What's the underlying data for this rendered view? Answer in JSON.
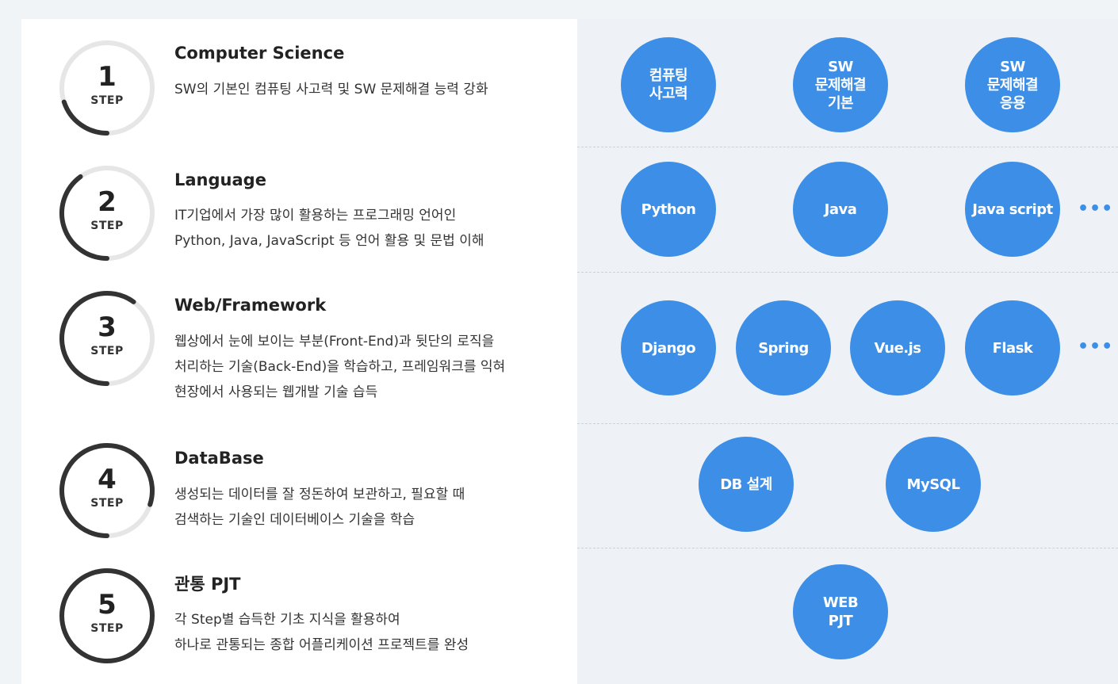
{
  "steps": [
    {
      "number": "1",
      "step_label": "STEP",
      "title": "Computer Science",
      "desc": [
        "SW의 기본인 컴퓨팅 사고력 및 SW 문제해결 능력 강화"
      ],
      "progress": 0.2
    },
    {
      "number": "2",
      "step_label": "STEP",
      "title": "Language",
      "desc": [
        "IT기업에서 가장 많이 활용하는 프로그래밍 언어인",
        "Python, Java, JavaScript 등 언어 활용 및 문법 이해"
      ],
      "progress": 0.4
    },
    {
      "number": "3",
      "step_label": "STEP",
      "title": "Web/Framework",
      "desc": [
        "웹상에서  눈에 보이는 부분(Front-End)과  뒷단의 로직을",
        "처리하는 기술(Back-End)을 학습하고, 프레임워크를 익혀",
        "현장에서 사용되는  웹개발 기술 습득"
      ],
      "progress": 0.6
    },
    {
      "number": "4",
      "step_label": "STEP",
      "title": "DataBase",
      "desc": [
        "생성되는 데이터를  잘 정돈하여 보관하고, 필요할 때",
        "검색하는 기술인 데이터베이스 기술을  학습"
      ],
      "progress": 0.8
    },
    {
      "number": "5",
      "step_label": "STEP",
      "title": "관통 PJT",
      "desc": [
        "각 Step별 습득한 기초 지식을 활용하여",
        "하나로 관통되는 종합 어플리케이션 프로젝트를 완성"
      ],
      "progress": 1.0
    }
  ],
  "topics": {
    "row1": [
      "컴퓨팅\n사고력",
      "SW\n문제해결\n기본",
      "SW\n문제해결\n응용"
    ],
    "row2": [
      "Python",
      "Java",
      "Java script"
    ],
    "row3": [
      "Django",
      "Spring",
      "Vue.js",
      "Flask"
    ],
    "row4": [
      "DB 설계",
      "MySQL"
    ],
    "row5": [
      "WEB\nPJT"
    ]
  },
  "more_label": "•••",
  "colors": {
    "accent": "#3d8ee6",
    "ring_active": "#333333",
    "ring_track": "#e6e6e6"
  }
}
